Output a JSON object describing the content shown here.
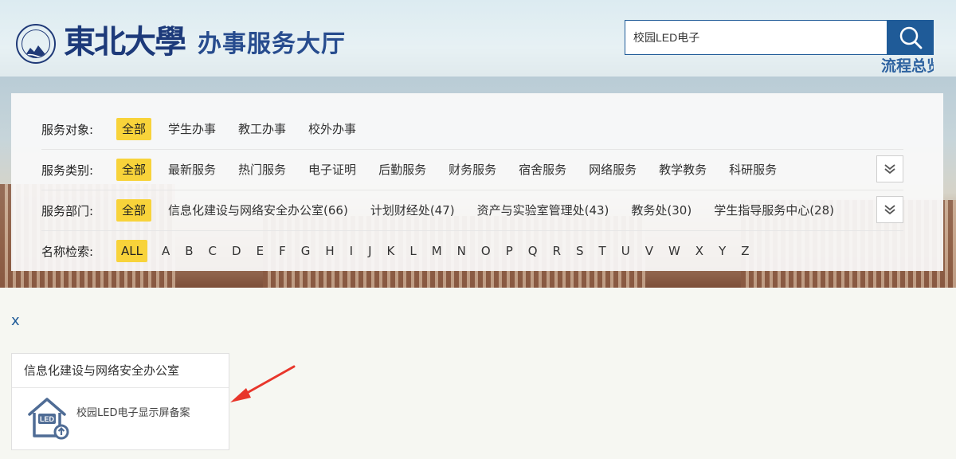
{
  "header": {
    "logo_name": "東北大學",
    "title": "办事服务大厅",
    "search": {
      "value": "校园LED电子",
      "icon": "search-icon"
    },
    "flow_link": "流程总览"
  },
  "filters": {
    "target": {
      "label": "服务对象:",
      "options": [
        "全部",
        "学生办事",
        "教工办事",
        "校外办事"
      ]
    },
    "category": {
      "label": "服务类别:",
      "options": [
        "全部",
        "最新服务",
        "热门服务",
        "电子证明",
        "后勤服务",
        "财务服务",
        "宿舍服务",
        "网络服务",
        "教学教务",
        "科研服务"
      ]
    },
    "department": {
      "label": "服务部门:",
      "options": [
        "全部",
        "信息化建设与网络安全办公室(66)",
        "计划财经处(47)",
        "资产与实验室管理处(43)",
        "教务处(30)",
        "学生指导服务中心(28)"
      ]
    },
    "name_search": {
      "label": "名称检索:",
      "options": [
        "ALL",
        "A",
        "B",
        "C",
        "D",
        "E",
        "F",
        "G",
        "H",
        "I",
        "J",
        "K",
        "L",
        "M",
        "N",
        "O",
        "P",
        "Q",
        "R",
        "S",
        "T",
        "U",
        "V",
        "W",
        "X",
        "Y",
        "Z"
      ]
    }
  },
  "clear": "x",
  "results": {
    "group_title": "信息化建设与网络安全办公室",
    "items": [
      {
        "name": "校园LED电子显示屏备案",
        "icon": "led-house-icon",
        "icon_text": "LED"
      }
    ]
  },
  "colors": {
    "accent_yellow": "#f8d33a",
    "brand_blue": "#1f5b98",
    "annotation_red": "#e8362b"
  }
}
